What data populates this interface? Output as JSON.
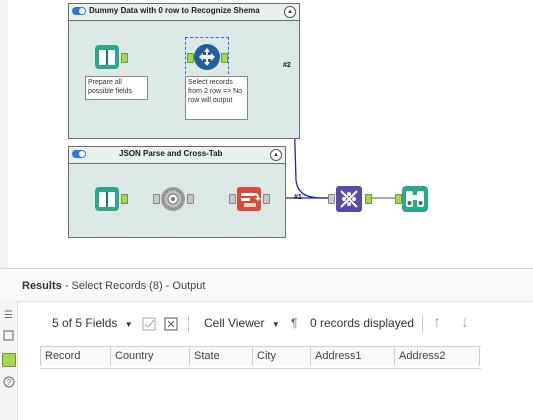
{
  "containers": [
    {
      "title": "Dummy Data with 0  row to Recognize Shema",
      "collapse": "▲"
    },
    {
      "title": "JSON Parse and Cross-Tab",
      "collapse": "▲"
    }
  ],
  "annotations": {
    "prepare_fields": "Prepare all possible fields",
    "select_records": "Select records from 2 row => No row will output"
  },
  "wire_labels": {
    "hash2": "#2",
    "hash1": "#1"
  },
  "icons": {
    "text_input": "text-input-icon",
    "select_records": "select-records-icon",
    "json_parse": "json-parse-icon",
    "crosstab": "crosstab-icon",
    "union": "union-icon",
    "browse": "browse-binoculars-icon"
  },
  "results": {
    "title": "Results",
    "subtitle": "- Select Records (8) - Output"
  },
  "toolbar": {
    "fields": "5 of 5 Fields",
    "viewer": "Cell Viewer",
    "records": "0 records displayed"
  },
  "columns": [
    "Record",
    "Country",
    "State",
    "City",
    "Address1",
    "Address2"
  ],
  "colors": {
    "container_bg": "#dce8e5",
    "accent_blue": "#2f7ad6",
    "anchor_green": "#a5d65a",
    "text_input_teal": "#2aa88a",
    "select_blue": "#1f5f9a",
    "union_purple": "#5a4aa8",
    "crosstab_red": "#d84a3a",
    "wire_blue": "#1c2aa8"
  }
}
